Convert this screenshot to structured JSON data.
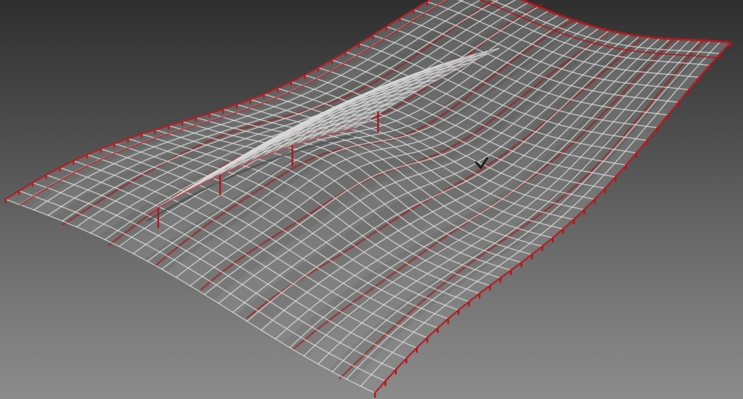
{
  "viewport": {
    "background_top": "#2f2f2f",
    "background_bottom": "#8c8c8c"
  },
  "model": {
    "surface_color": "#8a8a8a",
    "grid_color": "#d8d8d8",
    "rib_color": "#a01818",
    "edge_color": "#b3141a",
    "grid_columns": 26,
    "grid_rows": 34,
    "shell_grid_columns": 14,
    "shell_grid_rows": 18
  },
  "cursor": {
    "icon": "checkmark-cursor-icon"
  }
}
